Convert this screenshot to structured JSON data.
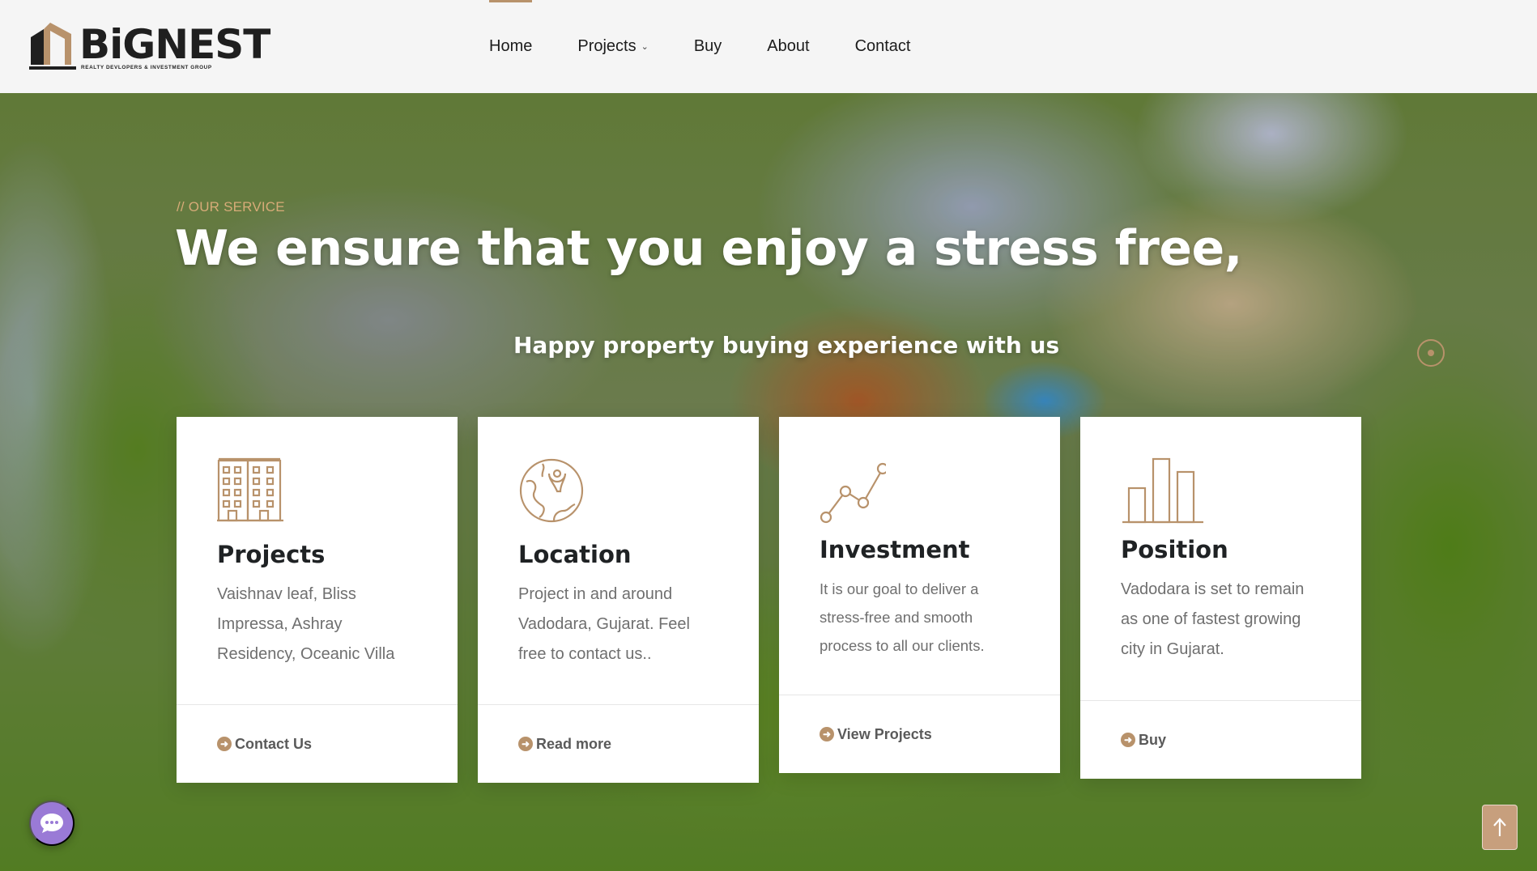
{
  "brand": {
    "name": "BiGNEST",
    "tagline": "REALTY DEVLOPERS & INVESTMENT GROUP",
    "logo_icon": "house-roof-icon"
  },
  "nav": {
    "items": [
      {
        "label": "Home",
        "active": true
      },
      {
        "label": "Projects",
        "has_dropdown": true
      },
      {
        "label": "Buy"
      },
      {
        "label": "About"
      },
      {
        "label": "Contact"
      }
    ]
  },
  "hero": {
    "eyebrow": "// OUR SERVICE",
    "title": "We ensure that you enjoy a stress free,",
    "subtitle": "Happy property buying experience with us"
  },
  "cards": [
    {
      "icon": "building-icon",
      "title": "Projects",
      "text": "Vaishnav leaf, Bliss Impressa, Ashray Residency, Oceanic Villa",
      "link": "Contact Us"
    },
    {
      "icon": "globe-location-icon",
      "title": "Location",
      "text": "Project in and around Vadodara, Gujarat. Feel free to contact us..",
      "link": "Read more"
    },
    {
      "icon": "line-chart-icon",
      "title": "Investment",
      "text": "It is our goal to deliver a stress-free and smooth process to all our clients.",
      "link": "View Projects"
    },
    {
      "icon": "bar-chart-icon",
      "title": "Position",
      "text": "Vadodara is set to remain as one of fastest growing city in Gujarat.",
      "link": "Buy"
    }
  ],
  "colors": {
    "accent": "#b8926b",
    "eyebrow": "#d7ab78",
    "chat_button": "#9a7ad6",
    "scroll_top_button": "#c79f7d"
  },
  "floating": {
    "chat_icon": "chat-bubble-icon",
    "scroll_top_icon": "arrow-up-icon"
  }
}
